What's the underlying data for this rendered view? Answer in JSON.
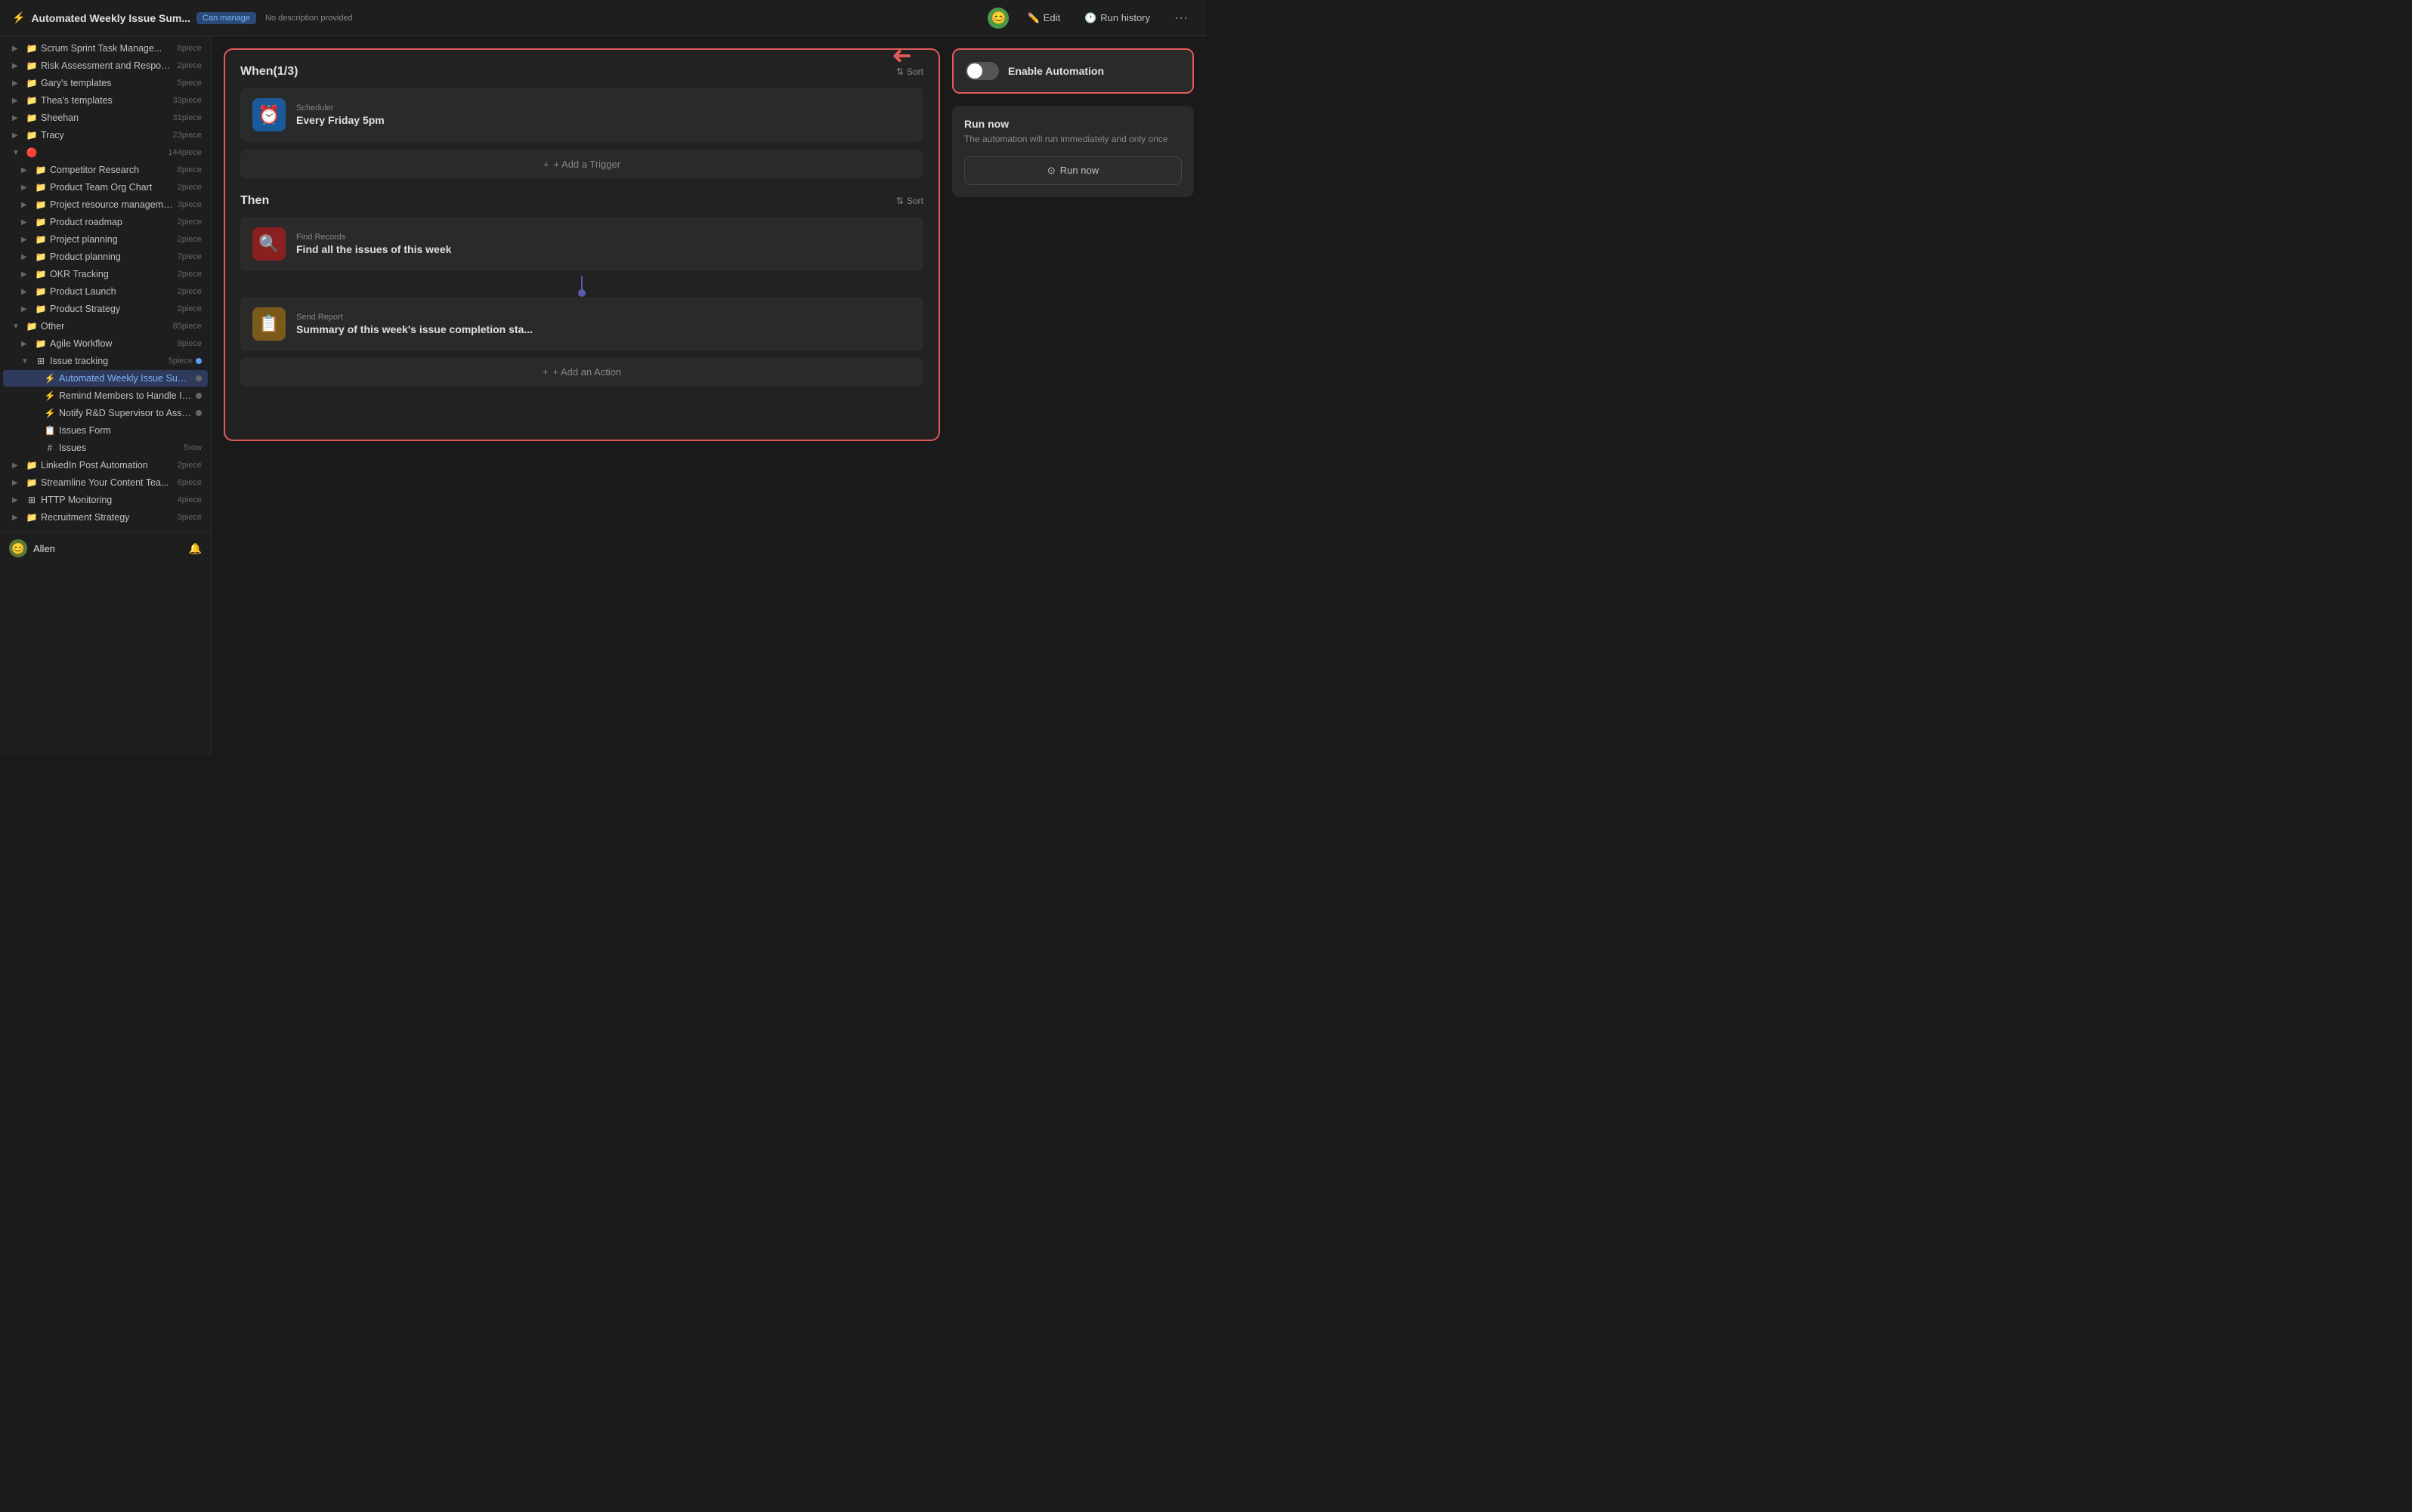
{
  "topbar": {
    "automation_icon": "⚡",
    "title": "Automated Weekly Issue Sum...",
    "badge": "Can manage",
    "subtitle": "No description provided",
    "avatar_emoji": "😊",
    "edit_label": "Edit",
    "run_history_label": "Run history",
    "edit_icon": "✏️",
    "history_icon": "🕐"
  },
  "sidebar": {
    "items": [
      {
        "indent": 0,
        "arrow": "▶",
        "icon": "📁",
        "label": "Scrum Sprint Task Manage...",
        "count": "8piece",
        "dot": ""
      },
      {
        "indent": 0,
        "arrow": "▶",
        "icon": "📁",
        "label": "Risk Assessment and Response...",
        "count": "2piece",
        "dot": ""
      },
      {
        "indent": 0,
        "arrow": "▶",
        "icon": "📁",
        "label": "Gary's templates",
        "count": "5piece",
        "dot": ""
      },
      {
        "indent": 0,
        "arrow": "▶",
        "icon": "📁",
        "label": "Thea's templates",
        "count": "33piece",
        "dot": ""
      },
      {
        "indent": 0,
        "arrow": "▶",
        "icon": "📁",
        "label": "Sheehan",
        "count": "31piece",
        "dot": ""
      },
      {
        "indent": 0,
        "arrow": "▶",
        "icon": "📁",
        "label": "Tracy",
        "count": "23piece",
        "dot": ""
      },
      {
        "indent": 0,
        "arrow": "▼",
        "icon": "🔴",
        "label": "",
        "count": "144piece",
        "dot": ""
      },
      {
        "indent": 1,
        "arrow": "▶",
        "icon": "📁",
        "label": "Competitor Research",
        "count": "8piece",
        "dot": ""
      },
      {
        "indent": 1,
        "arrow": "▶",
        "icon": "📁",
        "label": "Product Team Org Chart",
        "count": "2piece",
        "dot": ""
      },
      {
        "indent": 1,
        "arrow": "▶",
        "icon": "📁",
        "label": "Project resource management",
        "count": "3piece",
        "dot": ""
      },
      {
        "indent": 1,
        "arrow": "▶",
        "icon": "📁",
        "label": "Product roadmap",
        "count": "2piece",
        "dot": ""
      },
      {
        "indent": 1,
        "arrow": "▶",
        "icon": "📁",
        "label": "Project planning",
        "count": "2piece",
        "dot": ""
      },
      {
        "indent": 1,
        "arrow": "▶",
        "icon": "📁",
        "label": "Product planning",
        "count": "7piece",
        "dot": ""
      },
      {
        "indent": 1,
        "arrow": "▶",
        "icon": "📁",
        "label": "OKR Tracking",
        "count": "2piece",
        "dot": ""
      },
      {
        "indent": 1,
        "arrow": "▶",
        "icon": "📁",
        "label": "Product Launch",
        "count": "2piece",
        "dot": ""
      },
      {
        "indent": 1,
        "arrow": "▶",
        "icon": "📁",
        "label": "Product Strategy",
        "count": "2piece",
        "dot": ""
      },
      {
        "indent": 0,
        "arrow": "▼",
        "icon": "📁",
        "label": "Other",
        "count": "85piece",
        "dot": ""
      },
      {
        "indent": 1,
        "arrow": "▶",
        "icon": "📁",
        "label": "Agile Workflow",
        "count": "9piece",
        "dot": ""
      },
      {
        "indent": 1,
        "arrow": "▼",
        "icon": "⊞",
        "label": "Issue tracking",
        "count": "5piece",
        "dot": "blue"
      },
      {
        "indent": 2,
        "arrow": "",
        "icon": "⚡",
        "label": "Automated Weekly Issue Summ...",
        "count": "",
        "dot": "gray",
        "active": true
      },
      {
        "indent": 2,
        "arrow": "",
        "icon": "⚡",
        "label": "Remind Members to Handle Iss...",
        "count": "",
        "dot": "gray"
      },
      {
        "indent": 2,
        "arrow": "",
        "icon": "⚡",
        "label": "Notify R&D Supervisor to Assign...",
        "count": "",
        "dot": "gray"
      },
      {
        "indent": 2,
        "arrow": "",
        "icon": "📋",
        "label": "Issues Form",
        "count": "",
        "dot": ""
      },
      {
        "indent": 2,
        "arrow": "",
        "icon": "#",
        "label": "Issues",
        "count": "5row",
        "dot": ""
      },
      {
        "indent": 0,
        "arrow": "▶",
        "icon": "📁",
        "label": "LinkedIn Post Automation",
        "count": "2piece",
        "dot": ""
      },
      {
        "indent": 0,
        "arrow": "▶",
        "icon": "📁",
        "label": "Streamline Your Content Tea...",
        "count": "6piece",
        "dot": ""
      },
      {
        "indent": 0,
        "arrow": "▶",
        "icon": "⊞",
        "label": "HTTP Monitoring",
        "count": "4piece",
        "dot": ""
      },
      {
        "indent": 0,
        "arrow": "▶",
        "icon": "📁",
        "label": "Recruitment Strategy",
        "count": "3piece",
        "dot": ""
      }
    ],
    "user_label": "Allen",
    "user_emoji": "😊"
  },
  "automation": {
    "when_title": "When(1/3)",
    "sort_label": "Sort",
    "trigger_type": "Scheduler",
    "trigger_name": "Every Friday 5pm",
    "add_trigger_label": "+ Add a Trigger",
    "then_title": "Then",
    "action1_type": "Find Records",
    "action1_name": "Find all the issues of this week",
    "action2_type": "Send Report",
    "action2_name": "Summary of this week's issue completion sta...",
    "add_action_label": "+ Add an Action"
  },
  "right_panel": {
    "enable_label": "Enable Automation",
    "run_now_title": "Run now",
    "run_now_desc": "The automation will run immediately and only once",
    "run_now_btn_label": "Run now",
    "run_now_icon": "⭕"
  }
}
